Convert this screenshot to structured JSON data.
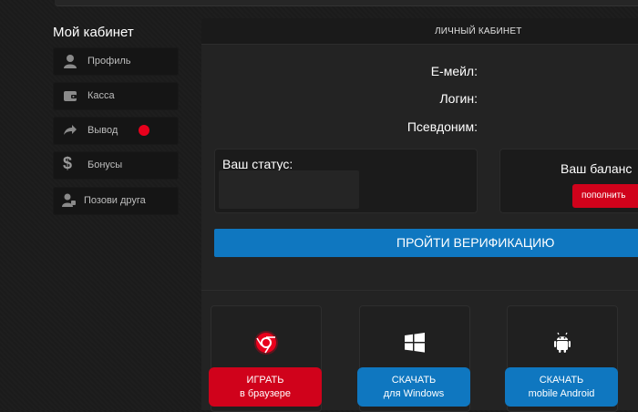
{
  "sidebar": {
    "title": "Мой кабинет",
    "items": [
      {
        "label": "Профиль",
        "icon": "user-icon"
      },
      {
        "label": "Касса",
        "icon": "wallet-icon"
      },
      {
        "label": "Вывод",
        "icon": "share-arrow-icon"
      },
      {
        "label": "Бонусы",
        "icon": "dollar-icon",
        "glyph": "$"
      },
      {
        "label": "Позови друга",
        "icon": "invite-friend-icon"
      }
    ]
  },
  "panel": {
    "title": "ЛИЧНЫЙ КАБИНЕТ",
    "fields": {
      "email": "Е-мейл:",
      "login": "Логин:",
      "nickname": "Псевдоним:"
    },
    "status_label": "Ваш статус:",
    "balance_label": "Ваш баланс",
    "topup_label": "пополнить",
    "verify_label": "ПРОЙТИ ВЕРИФИКАЦИЮ"
  },
  "downloads": [
    {
      "line1": "ИГРАТЬ",
      "line2": "в браузере",
      "icon": "chrome-icon"
    },
    {
      "line1": "СКАЧАТЬ",
      "line2": "для Windows",
      "icon": "windows-icon"
    },
    {
      "line1": "СКАЧАТЬ",
      "line2": "mobile Android",
      "icon": "android-icon"
    }
  ],
  "colors": {
    "accent_red": "#d0021b",
    "accent_blue": "#0f77c0",
    "notify": "#e8001c"
  }
}
